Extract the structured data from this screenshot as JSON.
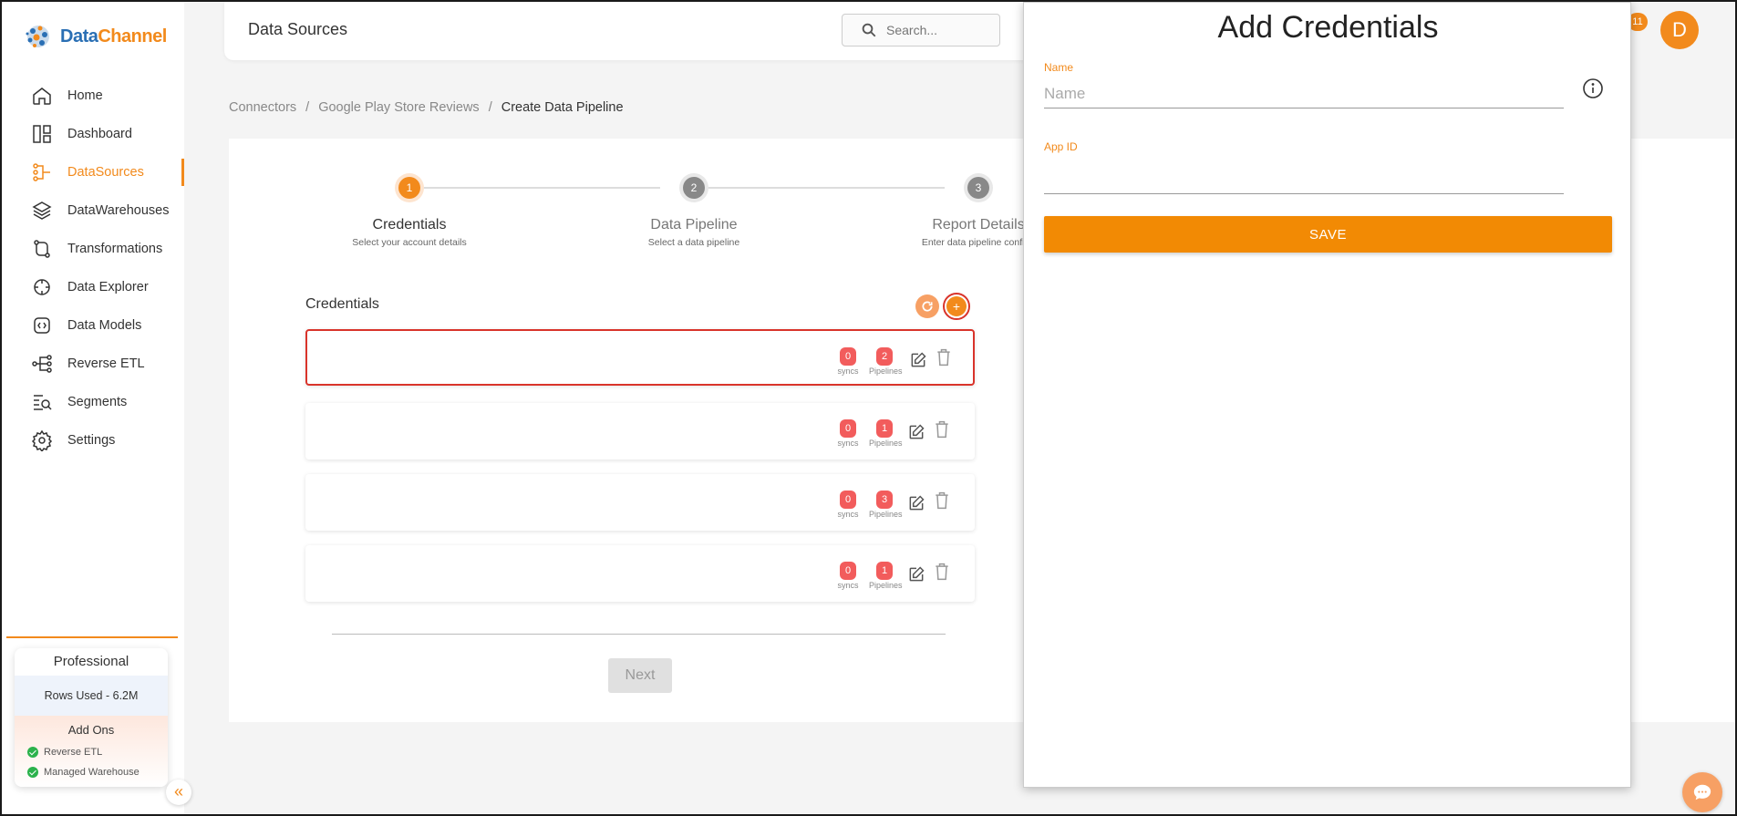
{
  "app": {
    "logo_part1": "Data",
    "logo_part2": "Channel"
  },
  "sidebar": {
    "items": [
      {
        "label": "Home",
        "icon": "home-icon"
      },
      {
        "label": "Dashboard",
        "icon": "dashboard-icon"
      },
      {
        "label": "DataSources",
        "icon": "datasources-icon",
        "active": true
      },
      {
        "label": "DataWarehouses",
        "icon": "layers-icon"
      },
      {
        "label": "Transformations",
        "icon": "transform-icon"
      },
      {
        "label": "Data Explorer",
        "icon": "explorer-icon"
      },
      {
        "label": "Data Models",
        "icon": "models-icon"
      },
      {
        "label": "Reverse ETL",
        "icon": "reverse-etl-icon"
      },
      {
        "label": "Segments",
        "icon": "segments-icon"
      },
      {
        "label": "Settings",
        "icon": "gear-icon"
      }
    ],
    "plan": {
      "title": "Professional",
      "rows_used": "Rows Used - 6.2M",
      "addons_title": "Add Ons",
      "addons": [
        "Reverse ETL",
        "Managed Warehouse"
      ]
    },
    "collapse_glyph": "«"
  },
  "header": {
    "title": "Data Sources",
    "search_placeholder": "Search...",
    "notification_count": "11",
    "avatar_initial": "D"
  },
  "breadcrumb": {
    "items": [
      "Connectors",
      "Google Play Store Reviews",
      "Create Data Pipeline"
    ],
    "separator": "/"
  },
  "stepper": {
    "steps": [
      {
        "number": "1",
        "title": "Credentials",
        "subtitle": "Select your account details",
        "active": true
      },
      {
        "number": "2",
        "title": "Data Pipeline",
        "subtitle": "Select a data pipeline",
        "active": false
      },
      {
        "number": "3",
        "title": "Report Details",
        "subtitle": "Enter data pipeline configu",
        "active": false
      }
    ]
  },
  "credentials": {
    "title": "Credentials",
    "add_glyph": "+",
    "syncs_label": "syncs",
    "pipelines_label": "Pipelines",
    "rows": [
      {
        "name": "",
        "syncs": "0",
        "pipelines": "2",
        "selected": true
      },
      {
        "name": "",
        "syncs": "0",
        "pipelines": "1",
        "selected": false
      },
      {
        "name": "",
        "syncs": "0",
        "pipelines": "3",
        "selected": false
      },
      {
        "name": "",
        "syncs": "0",
        "pipelines": "1",
        "selected": false
      }
    ],
    "next_label": "Next"
  },
  "drawer": {
    "title": "Add Credentials",
    "name_label": "Name",
    "name_placeholder": "Name",
    "name_value": "",
    "appid_label": "App ID",
    "appid_value": "",
    "save_label": "SAVE"
  },
  "colors": {
    "accent": "#f28a1c",
    "danger_outline": "#d9342b",
    "badge": "#f25c5c",
    "logo_blue": "#2a6fb4"
  }
}
